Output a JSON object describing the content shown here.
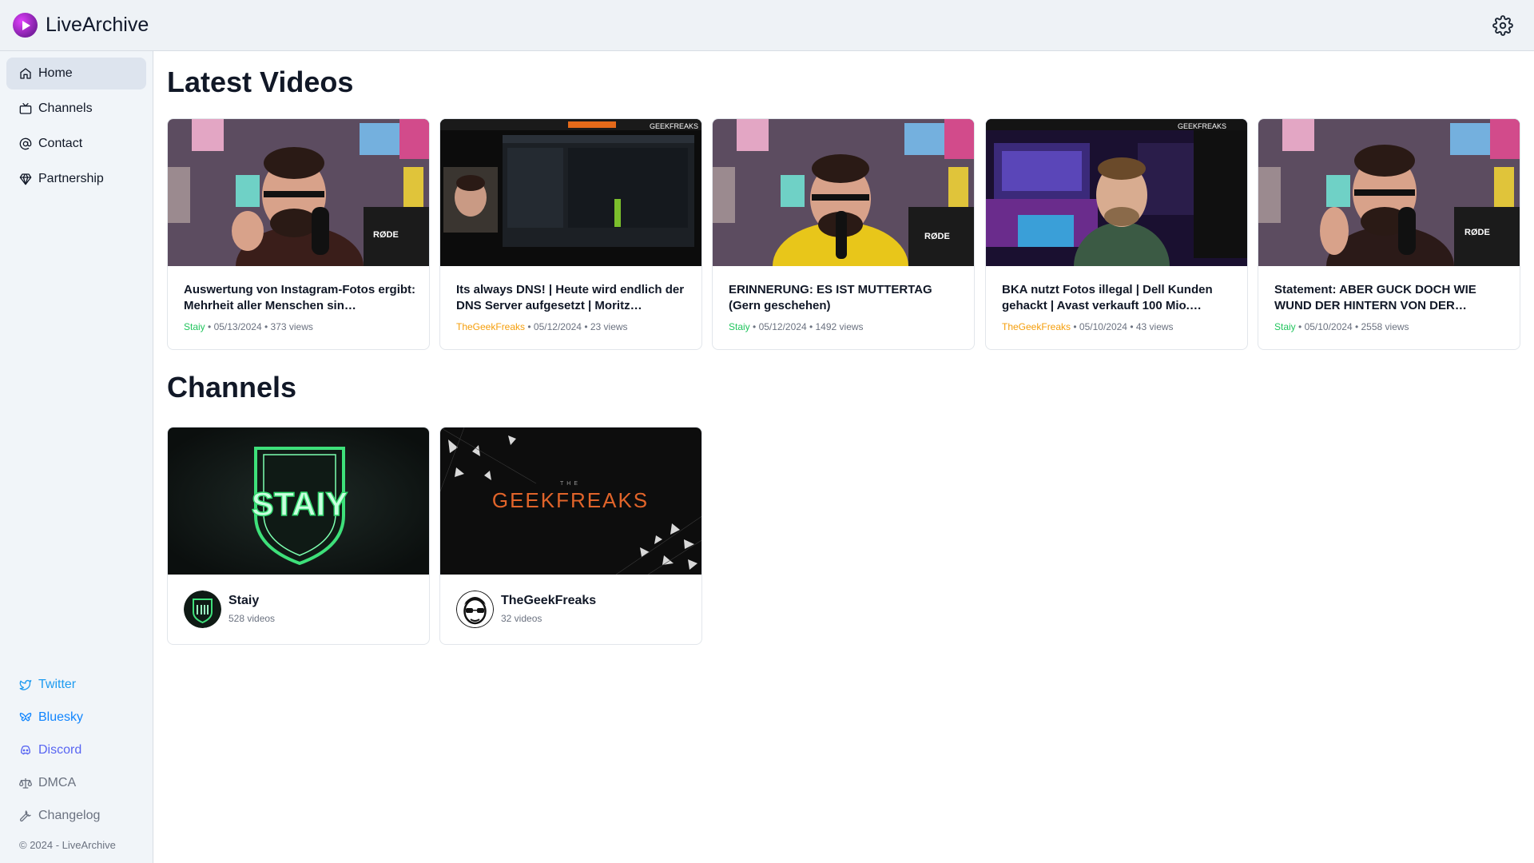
{
  "app": {
    "title": "LiveArchive"
  },
  "sidebar": {
    "nav": [
      {
        "label": "Home",
        "icon": "home-icon",
        "active": true
      },
      {
        "label": "Channels",
        "icon": "tv-icon",
        "active": false
      },
      {
        "label": "Contact",
        "icon": "at-sign-icon",
        "active": false
      },
      {
        "label": "Partnership",
        "icon": "gem-icon",
        "active": false
      }
    ],
    "links": [
      {
        "label": "Twitter",
        "icon": "twitter-icon",
        "color": "#1d9bf0"
      },
      {
        "label": "Bluesky",
        "icon": "butterfly-icon",
        "color": "#1185fe"
      },
      {
        "label": "Discord",
        "icon": "discord-icon",
        "color": "#5865f2"
      },
      {
        "label": "DMCA",
        "icon": "scale-icon",
        "color": "#6b7280"
      },
      {
        "label": "Changelog",
        "icon": "wrench-icon",
        "color": "#6b7280"
      }
    ],
    "copyright": "© 2024 - LiveArchive"
  },
  "main": {
    "latest_title": "Latest Videos",
    "channels_title": "Channels",
    "videos": [
      {
        "title": "Auswertung von Instagram-Fotos ergibt: Mehrheit aller Menschen sin…",
        "channel": "Staiy",
        "channel_color": "#22c55e",
        "date": "05/13/2024",
        "views": "373 views"
      },
      {
        "title": "Its always DNS! | Heute wird endlich der DNS Server aufgesetzt | Moritz…",
        "channel": "TheGeekFreaks",
        "channel_color": "#f59e0b",
        "date": "05/12/2024",
        "views": "23 views"
      },
      {
        "title": "ERINNERUNG: ES IST MUTTERTAG (Gern geschehen)",
        "channel": "Staiy",
        "channel_color": "#22c55e",
        "date": "05/12/2024",
        "views": "1492 views"
      },
      {
        "title": "BKA nutzt Fotos illegal | Dell Kunden gehackt | Avast verkauft 100 Mio.…",
        "channel": "TheGeekFreaks",
        "channel_color": "#f59e0b",
        "date": "05/10/2024",
        "views": "43 views"
      },
      {
        "title": "Statement: ABER GUCK DOCH WIE WUND DER HINTERN VON DER…",
        "channel": "Staiy",
        "channel_color": "#22c55e",
        "date": "05/10/2024",
        "views": "2558 views"
      }
    ],
    "channels": [
      {
        "name": "Staiy",
        "count": "528 videos",
        "banner_text": "STAIY"
      },
      {
        "name": "TheGeekFreaks",
        "count": "32 videos",
        "banner_text": "GEEKFREAKS",
        "banner_small": "THE"
      }
    ],
    "thumb_text": {
      "rode": "RØDE",
      "geekfreaks": "GEEKFREAKS"
    }
  }
}
